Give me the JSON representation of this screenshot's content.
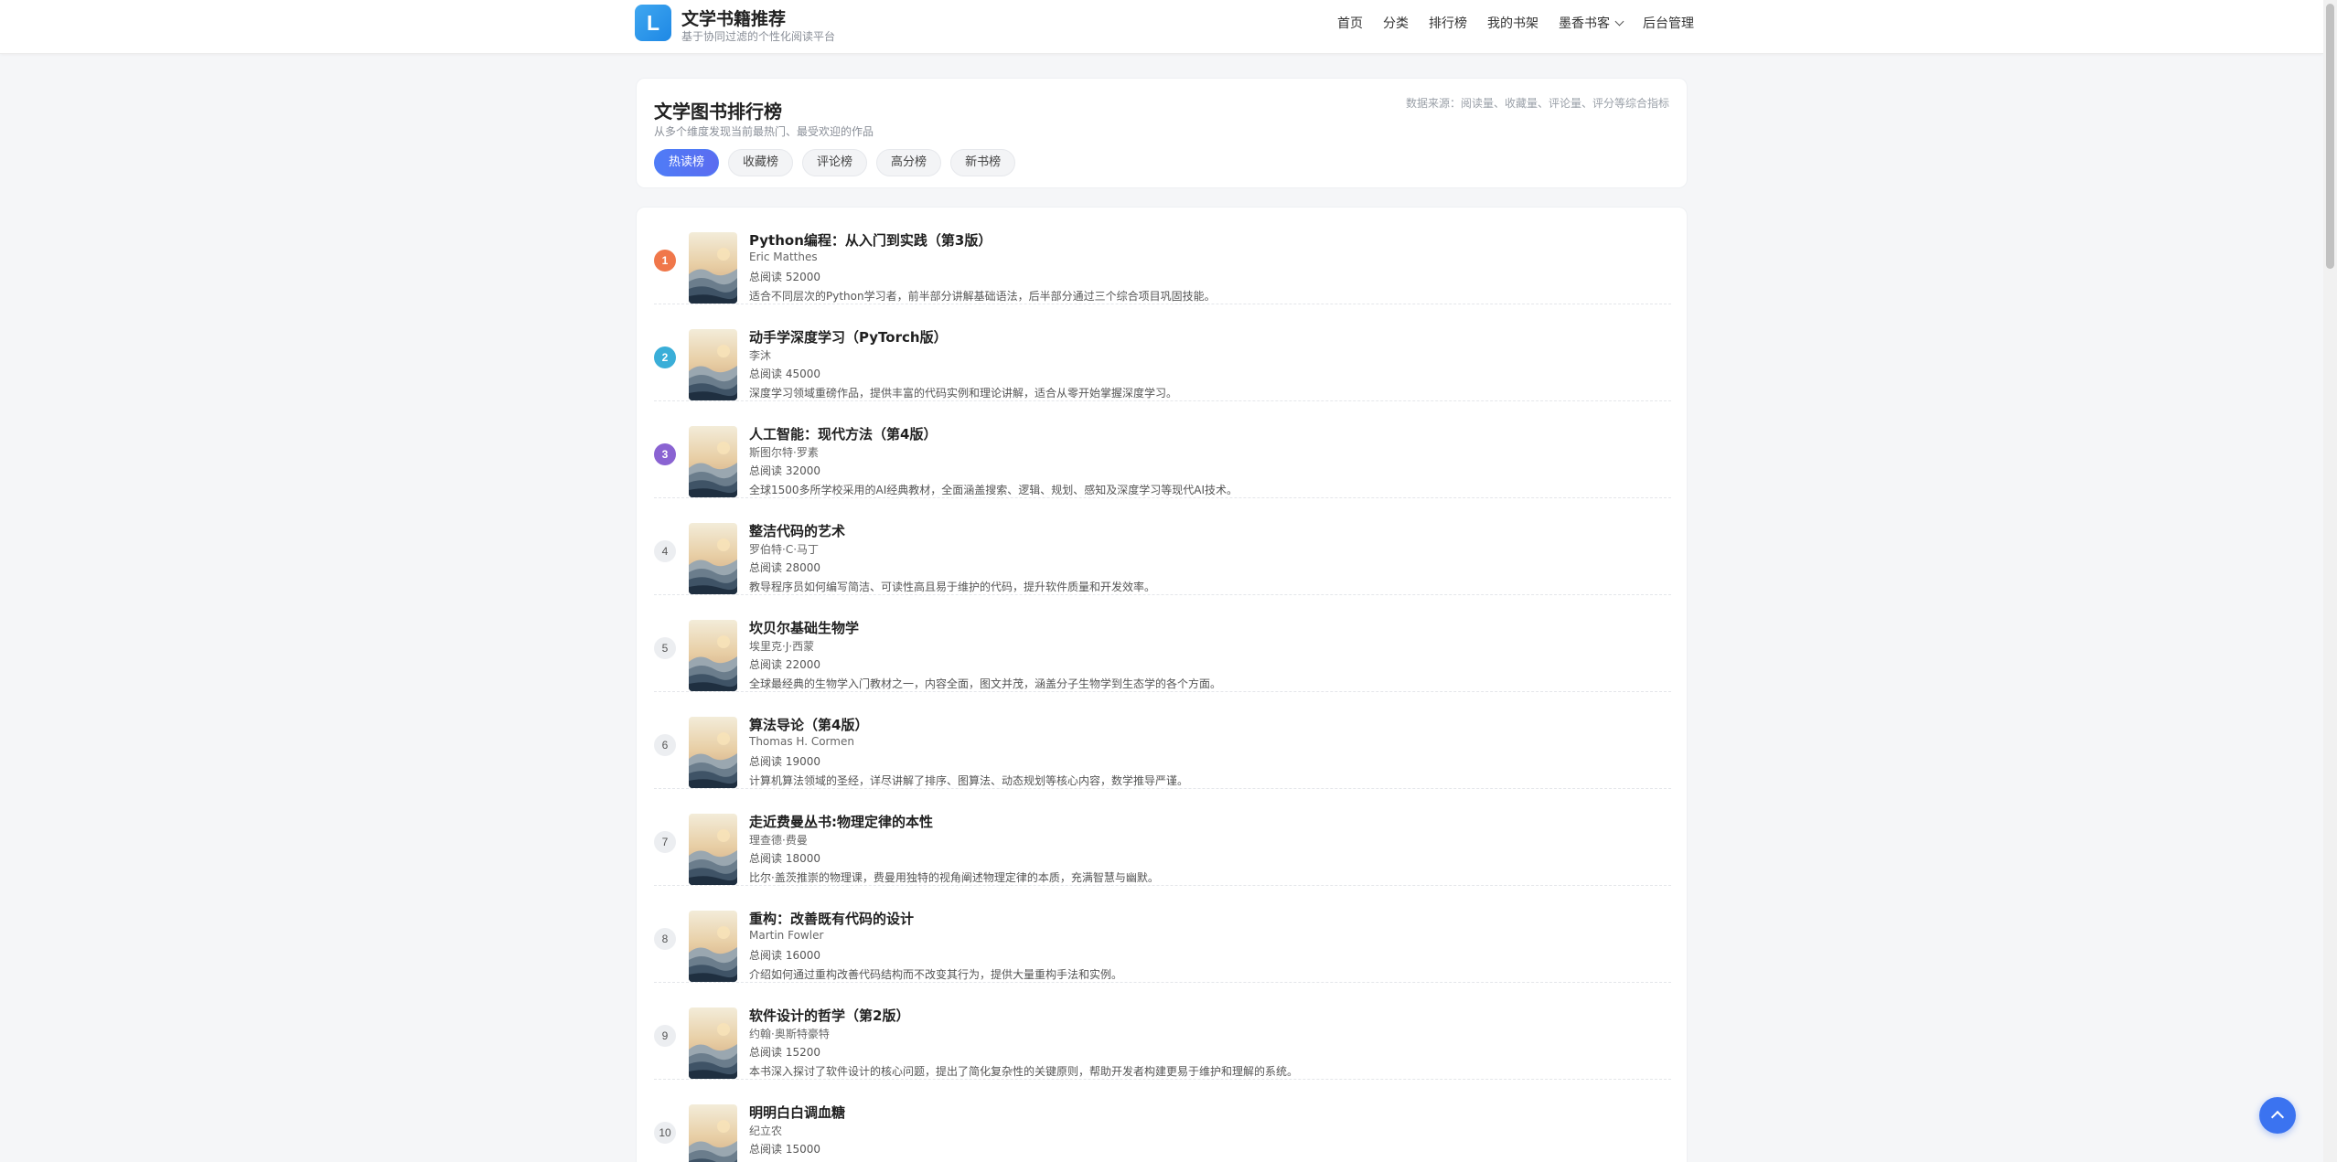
{
  "header": {
    "logo_letter": "L",
    "brand_name": "文学书籍推荐",
    "brand_sub": "基于协同过滤的个性化阅读平台",
    "nav": [
      "首页",
      "分类",
      "排行榜",
      "我的书架",
      "墨香书客",
      "后台管理"
    ]
  },
  "ranking": {
    "title": "文学图书排行榜",
    "subtitle": "从多个维度发现当前最热门、最受欢迎的作品",
    "source": "数据来源：阅读量、收藏量、评论量、评分等综合指标",
    "tabs": [
      "热读榜",
      "收藏榜",
      "评论榜",
      "高分榜",
      "新书榜"
    ],
    "active_tab": 0
  },
  "books": [
    {
      "rank": "1",
      "title": "Python编程：从入门到实践（第3版）",
      "author": "Eric Matthes",
      "reads": "总阅读 52000",
      "desc": "适合不同层次的Python学习者，前半部分讲解基础语法，后半部分通过三个综合项目巩固技能。"
    },
    {
      "rank": "2",
      "title": "动手学深度学习（PyTorch版）",
      "author": "李沐",
      "reads": "总阅读 45000",
      "desc": "深度学习领域重磅作品，提供丰富的代码实例和理论讲解，适合从零开始掌握深度学习。"
    },
    {
      "rank": "3",
      "title": "人工智能：现代方法（第4版）",
      "author": "斯图尔特·罗素",
      "reads": "总阅读 32000",
      "desc": "全球1500多所学校采用的AI经典教材，全面涵盖搜索、逻辑、规划、感知及深度学习等现代AI技术。"
    },
    {
      "rank": "4",
      "title": "整洁代码的艺术",
      "author": "罗伯特·C·马丁",
      "reads": "总阅读 28000",
      "desc": "教导程序员如何编写简洁、可读性高且易于维护的代码，提升软件质量和开发效率。"
    },
    {
      "rank": "5",
      "title": "坎贝尔基础生物学",
      "author": "埃里克·J·西蒙",
      "reads": "总阅读 22000",
      "desc": "全球最经典的生物学入门教材之一，内容全面，图文并茂，涵盖分子生物学到生态学的各个方面。"
    },
    {
      "rank": "6",
      "title": "算法导论（第4版）",
      "author": "Thomas H. Cormen",
      "reads": "总阅读 19000",
      "desc": "计算机算法领域的圣经，详尽讲解了排序、图算法、动态规划等核心内容，数学推导严谨。"
    },
    {
      "rank": "7",
      "title": "走近费曼丛书:物理定律的本性",
      "author": "理查德·费曼",
      "reads": "总阅读 18000",
      "desc": "比尔·盖茨推崇的物理课，费曼用独特的视角阐述物理定律的本质，充满智慧与幽默。"
    },
    {
      "rank": "8",
      "title": "重构：改善既有代码的设计",
      "author": "Martin Fowler",
      "reads": "总阅读 16000",
      "desc": "介绍如何通过重构改善代码结构而不改变其行为，提供大量重构手法和实例。"
    },
    {
      "rank": "9",
      "title": "软件设计的哲学（第2版）",
      "author": "约翰·奥斯特豪特",
      "reads": "总阅读 15200",
      "desc": "本书深入探讨了软件设计的核心问题，提出了简化复杂性的关键原则，帮助开发者构建更易于维护和理解的系统。"
    },
    {
      "rank": "10",
      "title": "明明白白调血糖",
      "author": "纪立农",
      "reads": "总阅读 15000",
      "desc": ""
    }
  ],
  "colors": {
    "rank1": "#f0774a",
    "rank2": "#3aaed8",
    "rank3": "#8a63d2",
    "accent": "#4f7cf7"
  },
  "icons": [
    "chevron-down-icon",
    "arrow-up-icon"
  ]
}
